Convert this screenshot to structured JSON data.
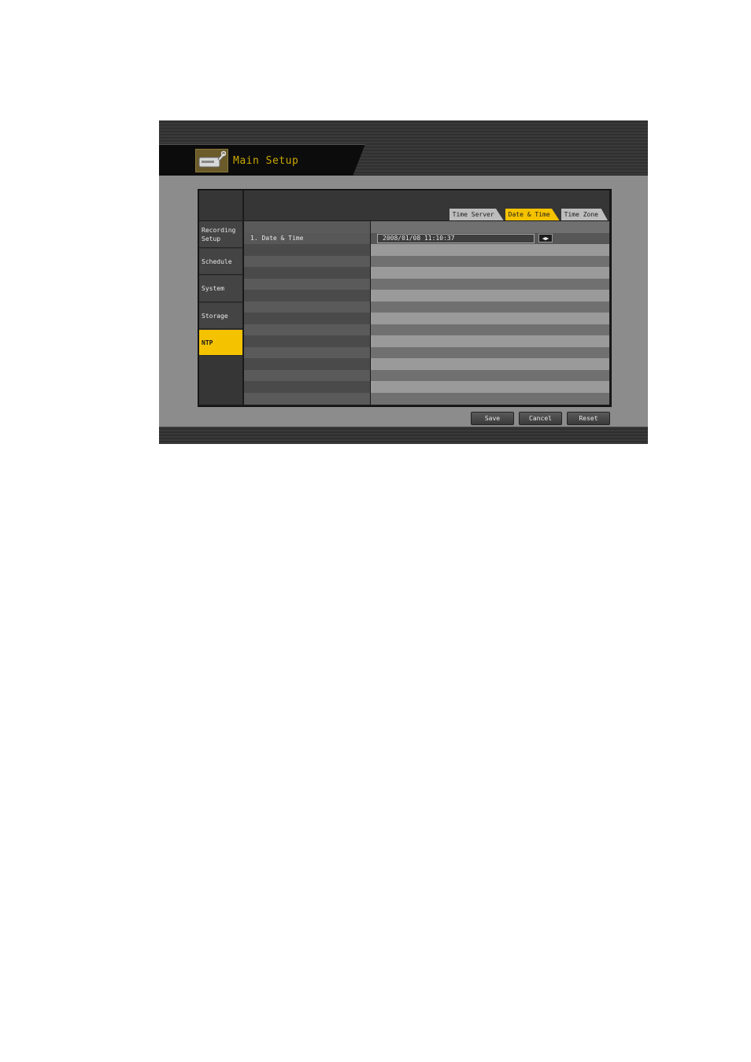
{
  "header": {
    "title": "Main Setup",
    "icon": "setup-icon"
  },
  "sidebar": {
    "items": [
      {
        "label": "Recording Setup",
        "active": false
      },
      {
        "label": "Schedule",
        "active": false
      },
      {
        "label": "System",
        "active": false
      },
      {
        "label": "Storage",
        "active": false
      },
      {
        "label": "NTP",
        "active": true
      }
    ]
  },
  "tabs": [
    {
      "label": "Time Server",
      "active": false
    },
    {
      "label": "Date & Time",
      "active": true
    },
    {
      "label": "Time Zone",
      "active": false
    }
  ],
  "settings": {
    "date_time_label": "1. Date & Time",
    "date_time_value": "2008/01/08    11:10:37",
    "adjust_arrows": "◀▶"
  },
  "buttons": {
    "save": "Save",
    "cancel": "Cancel",
    "reset": "Reset"
  },
  "colors": {
    "accent": "#f5c200",
    "title_text": "#c9a800"
  }
}
